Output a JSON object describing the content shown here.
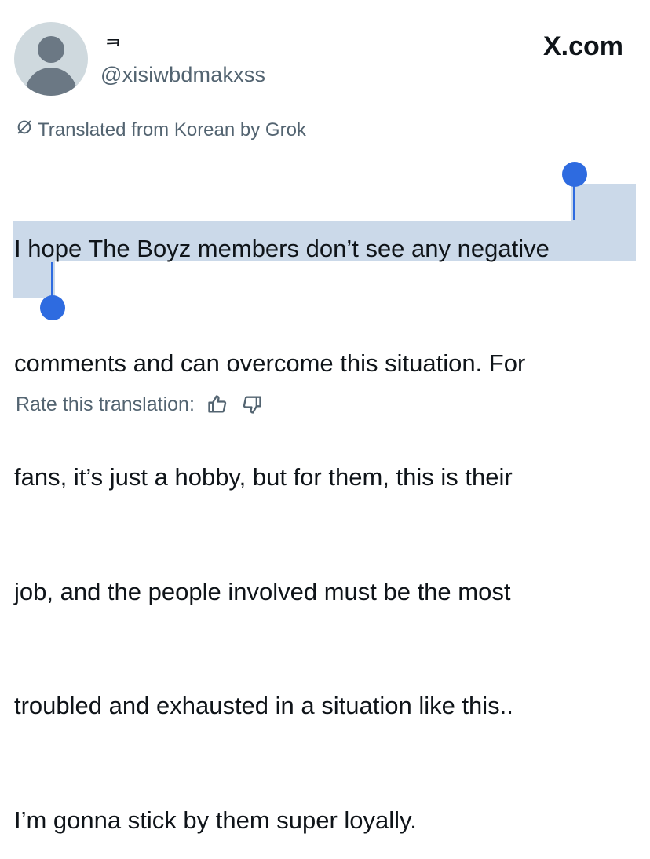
{
  "header": {
    "display_name": "ᄏ",
    "handle": "@xisiwbdmakxss",
    "brand": "X.com"
  },
  "translation_note": "Translated from Korean by Grok",
  "tweet": {
    "lines": [
      "I hope The Boyz members don’t see any negative",
      "comments and can overcome this situation. For",
      "fans, it’s just a hobby, but for them, this is their",
      "job, and the people involved must be the most",
      "troubled and exhausted in a situation like this..",
      "I’m gonna stick by them super loyally."
    ]
  },
  "rating": {
    "label": "Rate this translation:",
    "icons": [
      "thumbs-up-icon",
      "thumbs-down-icon"
    ]
  },
  "colors": {
    "selection": "#cbd9e9",
    "selection_handle": "#2e6be0",
    "secondary_text": "#536471"
  }
}
